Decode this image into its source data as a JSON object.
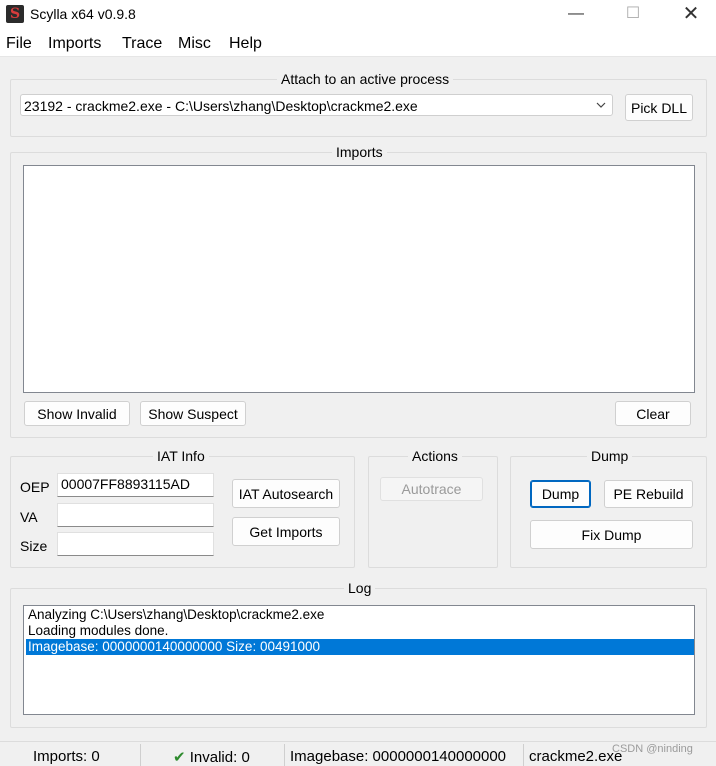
{
  "window": {
    "title": "Scylla x64 v0.9.8",
    "icon": "scylla-app-icon"
  },
  "menu": [
    "File",
    "Imports",
    "Trace",
    "Misc",
    "Help"
  ],
  "attach": {
    "group_title": "Attach to an active process",
    "process_selected": "23192 - crackme2.exe - C:\\Users\\zhang\\Desktop\\crackme2.exe",
    "pick_dll_label": "Pick DLL"
  },
  "imports": {
    "group_title": "Imports",
    "show_invalid_label": "Show Invalid",
    "show_suspect_label": "Show Suspect",
    "clear_label": "Clear"
  },
  "iat": {
    "group_title": "IAT Info",
    "oep_label": "OEP",
    "oep_value": "00007FF8893115AD",
    "va_label": "VA",
    "va_value": "",
    "size_label": "Size",
    "size_value": "",
    "autosearch_label": "IAT Autosearch",
    "get_imports_label": "Get Imports"
  },
  "actions": {
    "group_title": "Actions",
    "autotrace_label": "Autotrace"
  },
  "dump": {
    "group_title": "Dump",
    "dump_label": "Dump",
    "pe_rebuild_label": "PE Rebuild",
    "fix_dump_label": "Fix Dump"
  },
  "log": {
    "group_title": "Log",
    "lines": [
      "Analyzing C:\\Users\\zhang\\Desktop\\crackme2.exe",
      "Loading modules done.",
      "Imagebase: 0000000140000000 Size: 00491000"
    ],
    "selected_index": 2
  },
  "status": {
    "imports": "Imports: 0",
    "invalid": "Invalid: 0",
    "imagebase": "Imagebase: 0000000140000000",
    "module": "crackme2.exe"
  },
  "watermark": "CSDN @ninding",
  "colors": {
    "selection": "#0078d7",
    "focus_border": "#0067c0",
    "valid_check": "#2e8b2e"
  }
}
